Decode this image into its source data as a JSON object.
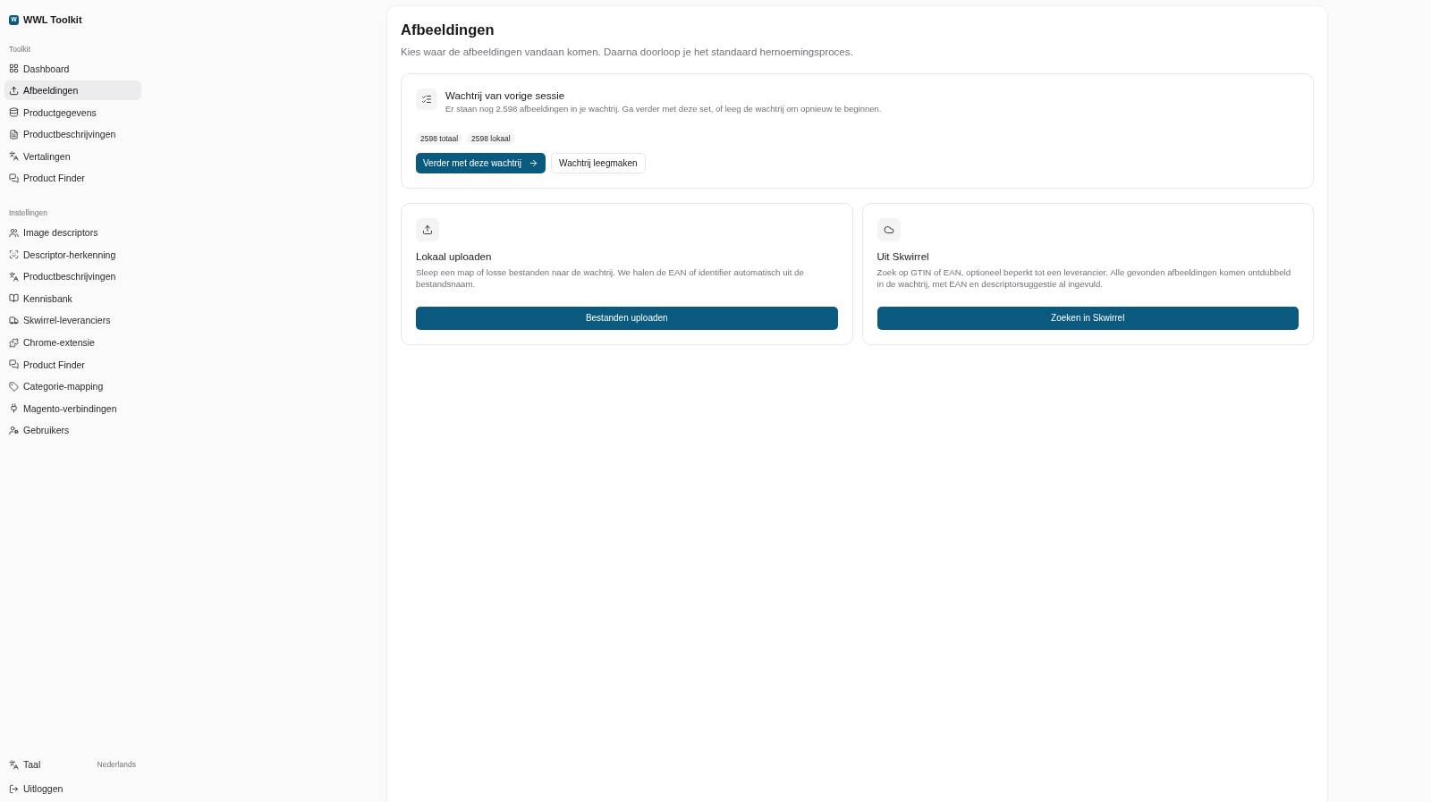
{
  "sidebar": {
    "brand": {
      "mark": "W",
      "name": "WWL Toolkit"
    },
    "groups": [
      {
        "label": "Toolkit",
        "items": [
          {
            "label": "Dashboard",
            "selected": false
          },
          {
            "label": "Afbeeldingen",
            "selected": true
          },
          {
            "label": "Productgegevens",
            "selected": false
          },
          {
            "label": "Productbeschrijvingen",
            "selected": false
          },
          {
            "label": "Vertalingen",
            "selected": false
          },
          {
            "label": "Product Finder",
            "selected": false
          }
        ]
      },
      {
        "label": "Instellingen",
        "items": [
          {
            "label": "Image descriptors",
            "selected": false
          },
          {
            "label": "Descriptor-herkenning",
            "selected": false
          },
          {
            "label": "Productbeschrijvingen",
            "selected": false
          },
          {
            "label": "Kennisbank",
            "selected": false
          },
          {
            "label": "Skwirrel-leveranciers",
            "selected": false
          },
          {
            "label": "Chrome-extensie",
            "selected": false
          },
          {
            "label": "Product Finder",
            "selected": false
          },
          {
            "label": "Categorie-mapping",
            "selected": false
          },
          {
            "label": "Magento-verbindingen",
            "selected": false
          },
          {
            "label": "Gebruikers",
            "selected": false
          }
        ]
      }
    ],
    "footer": {
      "language": {
        "label": "Taal",
        "value": "Nederlands"
      },
      "logout": {
        "label": "Uitloggen"
      }
    }
  },
  "page": {
    "title": "Afbeeldingen",
    "subtitle": "Kies waar de afbeeldingen vandaan komen. Daarna doorloop je het standaard hernoemingsproces."
  },
  "queue_card": {
    "title": "Wachtrij van vorige sessie",
    "description": "Er staan nog 2.598 afbeeldingen in je wachtrij. Ga verder met deze set, of leeg de wachtrij om opnieuw te beginnen.",
    "badges": [
      "2598 totaal",
      "2598 lokaal"
    ],
    "primary_button": "Verder met deze wachtrij",
    "secondary_button": "Wachtrij leegmaken"
  },
  "source_cards": [
    {
      "title": "Lokaal uploaden",
      "description": "Sleep een map of losse bestanden naar de wachtrij. We halen de EAN of identifier automatisch uit de bestandsnaam.",
      "button": "Bestanden uploaden"
    },
    {
      "title": "Uit Skwirrel",
      "description": "Zoek op GTIN of EAN, optioneel beperkt tot een leverancier. Alle gevonden afbeeldingen komen ontdubbeld in de wachtrij, met EAN en descriptorsuggestie al ingevuld.",
      "button": "Zoeken in Skwirrel"
    }
  ]
}
